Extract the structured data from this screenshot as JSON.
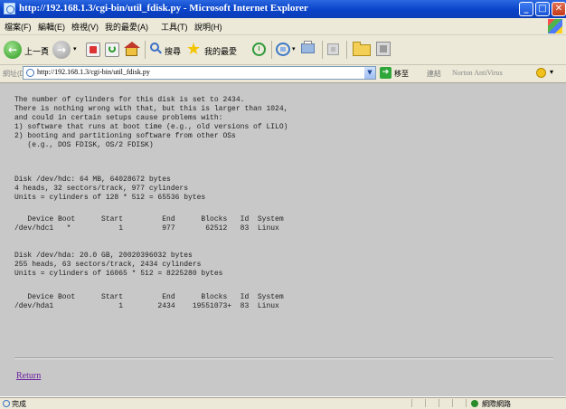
{
  "window": {
    "title": "http://192.168.1.3/cgi-bin/util_fdisk.py - Microsoft Internet Explorer"
  },
  "menu": {
    "items": [
      "檔案(F)",
      "編輯(E)",
      "檢視(V)",
      "我的最愛(A)",
      "工具(T)",
      "說明(H)"
    ]
  },
  "toolbar": {
    "back_label": "上一頁",
    "search_label": "搜尋",
    "favorites_label": "我的最愛"
  },
  "address": {
    "label": "網址(D)",
    "url": "http://192.168.1.3/cgi-bin/util_fdisk.py",
    "go_label": "移至",
    "links_label": "連結",
    "norton_label": "Norton AntiVirus"
  },
  "content": {
    "intro": "The number of cylinders for this disk is set to 2434.\nThere is nothing wrong with that, but this is larger than 1024,\nand could in certain setups cause problems with:\n1) software that runs at boot time (e.g., old versions of LILO)\n2) booting and partitioning software from other OSs\n   (e.g., DOS FDISK, OS/2 FDISK)",
    "disk1_info": "Disk /dev/hdc: 64 MB, 64028672 bytes\n4 heads, 32 sectors/track, 977 cylinders\nUnits = cylinders of 128 * 512 = 65536 bytes",
    "disk1_table": "   Device Boot      Start         End      Blocks   Id  System\n/dev/hdc1   *           1         977       62512   83  Linux",
    "disk2_info": "Disk /dev/hda: 20.0 GB, 20020396032 bytes\n255 heads, 63 sectors/track, 2434 cylinders\nUnits = cylinders of 16065 * 512 = 8225280 bytes",
    "disk2_table": "   Device Boot      Start         End      Blocks   Id  System\n/dev/hda1               1        2434    19551073+  83  Linux",
    "return_link": "Return"
  },
  "status": {
    "text": "完成",
    "zone": "網際網路"
  }
}
